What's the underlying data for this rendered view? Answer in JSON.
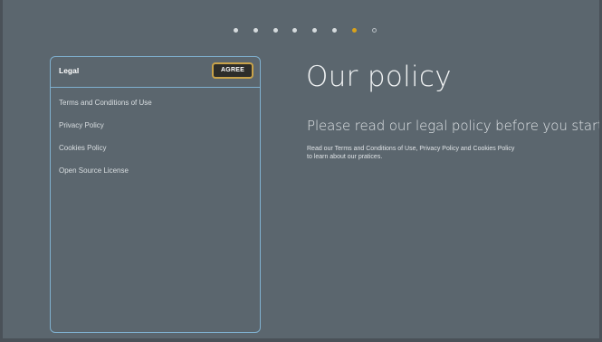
{
  "pager": {
    "total": 8,
    "current": 7,
    "dots": [
      "done",
      "done",
      "done",
      "done",
      "done",
      "done",
      "active",
      "pending"
    ]
  },
  "legal": {
    "title": "Legal",
    "agree_label": "AGREE",
    "items": [
      {
        "label": "Terms and Conditions of Use"
      },
      {
        "label": "Privacy Policy"
      },
      {
        "label": "Cookies Policy"
      },
      {
        "label": "Open Source License"
      }
    ]
  },
  "main": {
    "title": "Our policy",
    "subtitle": "Please read our legal policy before you start.",
    "description_line1": "Read our Terms and Conditions of Use, Privacy Policy and Cookies Policy",
    "description_line2": "to learn about our pratices."
  },
  "colors": {
    "background": "#5b666e",
    "panel_border": "#7fb0cf",
    "active_dot": "#d9a21b",
    "button_border": "#c9a34a",
    "button_bg": "#2d2d2a"
  }
}
